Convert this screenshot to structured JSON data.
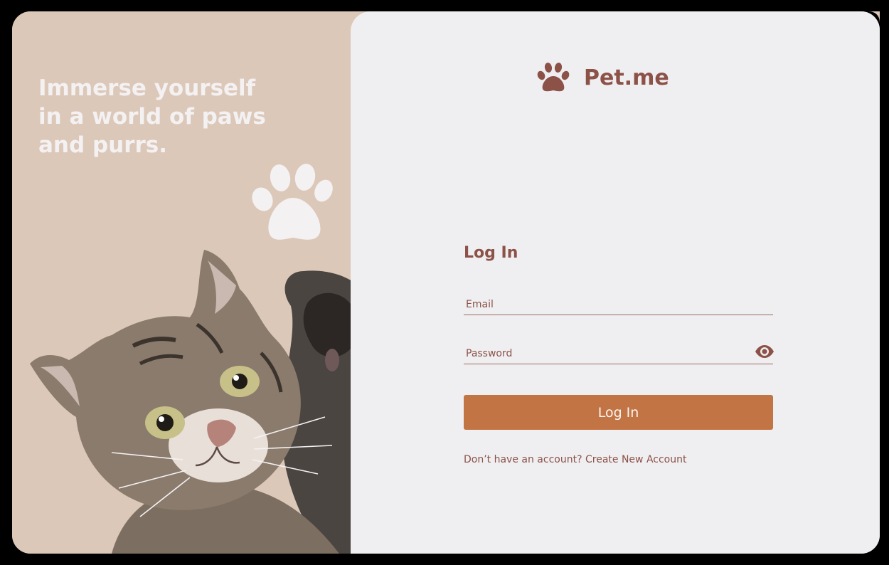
{
  "hero": {
    "tagline": "Immerse  yourself\nin a world of paws\nand purrs."
  },
  "brand": {
    "name": "Pet.me",
    "logo_icon": "paw-icon"
  },
  "login_form": {
    "title": "Log In",
    "email_placeholder": "Email",
    "password_placeholder": "Password",
    "password_toggle_icon": "eye-icon",
    "submit_label": "Log In",
    "signup_prompt": "Don’t have an account?",
    "signup_link": "Create New Account"
  },
  "colors": {
    "left_background": "#dcc8b8",
    "right_background": "#efeff1",
    "brand_text": "#8c5147",
    "button": "#c27444",
    "hero_text": "#f4f1f3"
  }
}
